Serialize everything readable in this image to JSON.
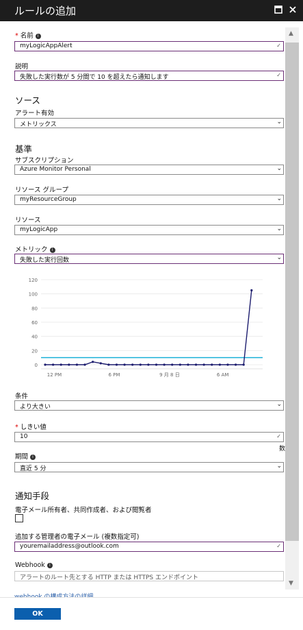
{
  "window": {
    "title": "ルールの追加"
  },
  "name": {
    "label": "名前",
    "value": "myLogicAppAlert"
  },
  "description": {
    "label": "説明",
    "value": "失敗した実行数が 5 分間で 10 を超えたら通知します"
  },
  "source": {
    "heading": "ソース",
    "alert_on_label": "アラート有効",
    "alert_on_value": "メトリックス"
  },
  "criteria": {
    "heading": "基準",
    "subscription_label": "サブスクリプション",
    "subscription_value": "Azure Monitor Personal",
    "resource_group_label": "リソース グループ",
    "resource_group_value": "myResourceGroup",
    "resource_label": "リソース",
    "resource_value": "myLogicApp",
    "metric_label": "メトリック",
    "metric_value": "失敗した実行回数",
    "condition_label": "条件",
    "condition_value": "より大きい",
    "threshold_label": "しきい値",
    "threshold_value": "10",
    "threshold_unit": "数",
    "period_label": "期間",
    "period_value": "直近 5 分"
  },
  "chart_data": {
    "type": "line",
    "x_ticks": [
      "12 PM",
      "6 PM",
      "9 月 8 日",
      "6 AM"
    ],
    "y_ticks": [
      "0",
      "20",
      "40",
      "60",
      "80",
      "100",
      "120"
    ],
    "ylim": [
      0,
      120
    ],
    "series": [
      {
        "values": [
          0,
          0,
          0,
          0,
          0,
          0,
          4,
          2,
          0,
          0,
          0,
          0,
          0,
          0,
          0,
          0,
          0,
          0,
          0,
          0,
          0,
          0,
          0,
          0,
          0,
          0,
          105
        ]
      }
    ],
    "threshold": 10,
    "colors": {
      "series": "#1c1c6e",
      "threshold": "#1ab0d8"
    }
  },
  "notify": {
    "heading": "通知手段",
    "email_owners_label": "電子メール所有者、共同作成者、および閲覧者",
    "admin_email_label": "追加する管理者の電子メール (複数指定可)",
    "admin_email_value": "youremailaddress@outlook.com",
    "webhook_label": "Webhook",
    "webhook_placeholder": "アラートのルート先とする HTTP または HTTPS エンドポイント",
    "webhook_link": "webhook の構成方法の詳細"
  },
  "footer": {
    "ok_label": "OK"
  },
  "colors": {
    "titlebar": "#1d1d1d",
    "accent": "#0b5fae",
    "focus_border": "#6b2f76"
  }
}
